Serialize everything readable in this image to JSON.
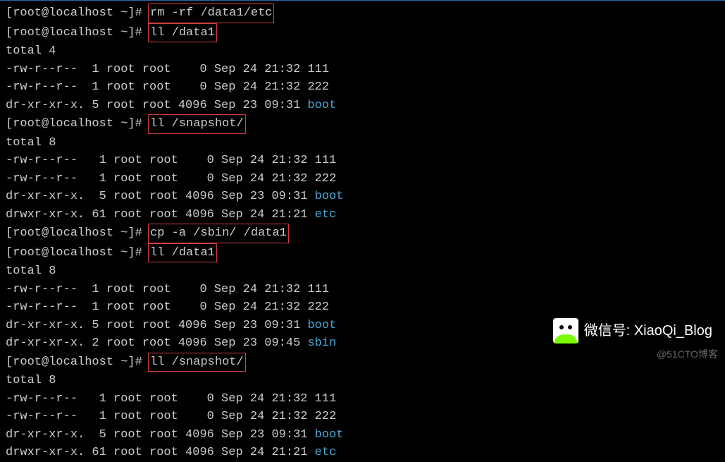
{
  "prompts": {
    "p1": "[root@localhost ~]# ",
    "p2": "[root@localhost ~]# ",
    "p3": "[root@localhost ~]# ",
    "p4": "[root@localhost ~]# ",
    "p5": "[root@localhost ~]# ",
    "p6": "[root@localhost ~]# "
  },
  "cmds": {
    "c1": "rm -rf /data1/etc",
    "c2": "ll /data1",
    "c3": "ll /snapshot/",
    "c4": "cp -a /sbin/ /data1",
    "c5": "ll /data1",
    "c6": "ll /snapshot/"
  },
  "blocks": {
    "b1": {
      "total": "total 4",
      "rows": [
        {
          "perm": "-rw-r--r--",
          "lnk": "  1",
          "own": "root",
          "grp": "root",
          "size": "    0",
          "date": "Sep 24 21:32",
          "name": "111",
          "color": false
        },
        {
          "perm": "-rw-r--r--",
          "lnk": "  1",
          "own": "root",
          "grp": "root",
          "size": "    0",
          "date": "Sep 24 21:32",
          "name": "222",
          "color": false
        },
        {
          "perm": "dr-xr-xr-x.",
          "lnk": " 5",
          "own": "root",
          "grp": "root",
          "size": " 4096",
          "date": "Sep 23 09:31",
          "name": "boot",
          "color": true
        }
      ]
    },
    "b2": {
      "total": "total 8",
      "rows": [
        {
          "perm": "-rw-r--r--",
          "lnk": "   1",
          "own": "root",
          "grp": "root",
          "size": "    0",
          "date": "Sep 24 21:32",
          "name": "111",
          "color": false
        },
        {
          "perm": "-rw-r--r--",
          "lnk": "   1",
          "own": "root",
          "grp": "root",
          "size": "    0",
          "date": "Sep 24 21:32",
          "name": "222",
          "color": false
        },
        {
          "perm": "dr-xr-xr-x.",
          "lnk": "  5",
          "own": "root",
          "grp": "root",
          "size": " 4096",
          "date": "Sep 23 09:31",
          "name": "boot",
          "color": true
        },
        {
          "perm": "drwxr-xr-x.",
          "lnk": " 61",
          "own": "root",
          "grp": "root",
          "size": " 4096",
          "date": "Sep 24 21:21",
          "name": "etc",
          "color": true
        }
      ]
    },
    "b3": {
      "total": "total 8",
      "rows": [
        {
          "perm": "-rw-r--r--",
          "lnk": "  1",
          "own": "root",
          "grp": "root",
          "size": "    0",
          "date": "Sep 24 21:32",
          "name": "111",
          "color": false
        },
        {
          "perm": "-rw-r--r--",
          "lnk": "  1",
          "own": "root",
          "grp": "root",
          "size": "    0",
          "date": "Sep 24 21:32",
          "name": "222",
          "color": false
        },
        {
          "perm": "dr-xr-xr-x.",
          "lnk": " 5",
          "own": "root",
          "grp": "root",
          "size": " 4096",
          "date": "Sep 23 09:31",
          "name": "boot",
          "color": true
        },
        {
          "perm": "dr-xr-xr-x.",
          "lnk": " 2",
          "own": "root",
          "grp": "root",
          "size": " 4096",
          "date": "Sep 23 09:45",
          "name": "sbin",
          "color": true
        }
      ]
    },
    "b4": {
      "total": "total 8",
      "rows": [
        {
          "perm": "-rw-r--r--",
          "lnk": "   1",
          "own": "root",
          "grp": "root",
          "size": "    0",
          "date": "Sep 24 21:32",
          "name": "111",
          "color": false
        },
        {
          "perm": "-rw-r--r--",
          "lnk": "   1",
          "own": "root",
          "grp": "root",
          "size": "    0",
          "date": "Sep 24 21:32",
          "name": "222",
          "color": false
        },
        {
          "perm": "dr-xr-xr-x.",
          "lnk": "  5",
          "own": "root",
          "grp": "root",
          "size": " 4096",
          "date": "Sep 23 09:31",
          "name": "boot",
          "color": true
        },
        {
          "perm": "drwxr-xr-x.",
          "lnk": " 61",
          "own": "root",
          "grp": "root",
          "size": " 4096",
          "date": "Sep 24 21:21",
          "name": "etc",
          "color": true
        }
      ]
    }
  },
  "watermark": {
    "label": "微信号: XiaoQi_Blog"
  },
  "credit": "@51CTO博客"
}
